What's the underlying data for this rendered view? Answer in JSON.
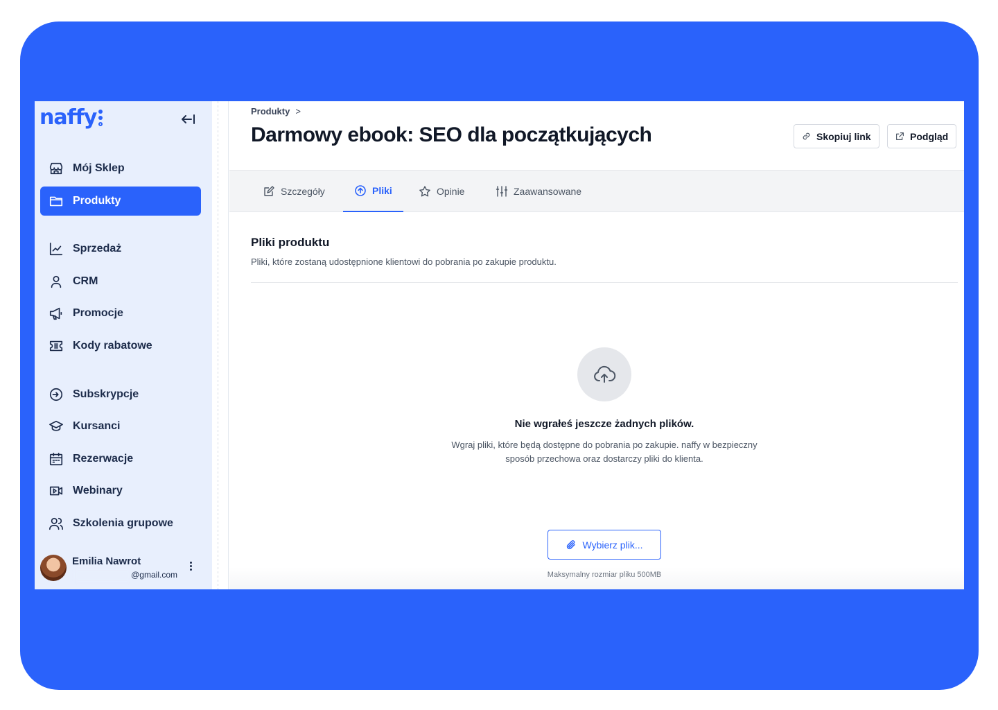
{
  "brand": {
    "logo_text": "naffy",
    "accent": "#2a62fb",
    "frame_bg": "#2a62fb"
  },
  "sidebar": {
    "items": [
      {
        "label": "Mój Sklep",
        "icon": "store-icon"
      },
      {
        "label": "Produkty",
        "icon": "folder-icon",
        "active": true
      },
      {
        "label": "Sprzedaż",
        "icon": "chart-line-icon"
      },
      {
        "label": "CRM",
        "icon": "user-icon"
      },
      {
        "label": "Promocje",
        "icon": "megaphone-icon"
      },
      {
        "label": "Kody rabatowe",
        "icon": "ticket-icon"
      },
      {
        "label": "Subskrypcje",
        "icon": "subscription-icon"
      },
      {
        "label": "Kursanci",
        "icon": "graduation-cap-icon"
      },
      {
        "label": "Rezerwacje",
        "icon": "calendar-icon"
      },
      {
        "label": "Webinary",
        "icon": "video-icon"
      },
      {
        "label": "Szkolenia grupowe",
        "icon": "users-icon"
      }
    ],
    "user": {
      "name": "Emilia Nawrot",
      "email": "@gmail.com"
    }
  },
  "header": {
    "breadcrumb": "Produkty",
    "breadcrumb_sep": ">",
    "title": "Darmowy ebook: SEO dla początkujących",
    "copy_link_label": "Skopiuj link",
    "preview_label": "Podgląd"
  },
  "tabs": [
    {
      "label": "Szczegóły",
      "icon": "edit-icon"
    },
    {
      "label": "Pliki",
      "icon": "upload-icon",
      "active": true
    },
    {
      "label": "Opinie",
      "icon": "star-icon"
    },
    {
      "label": "Zaawansowane",
      "icon": "sliders-icon"
    }
  ],
  "files": {
    "section_title": "Pliki produktu",
    "section_desc": "Pliki, które zostaną udostępnione klientowi do pobrania po zakupie produktu.",
    "empty_title": "Nie wgrałeś jeszcze żadnych plików.",
    "empty_desc": "Wgraj pliki, które będą dostępne do pobrania po zakupie. naffy w bezpieczny sposób przechowa oraz dostarczy pliki do klienta.",
    "choose_label": "Wybierz plik...",
    "max_size": "Maksymalny rozmiar pliku 500MB"
  }
}
